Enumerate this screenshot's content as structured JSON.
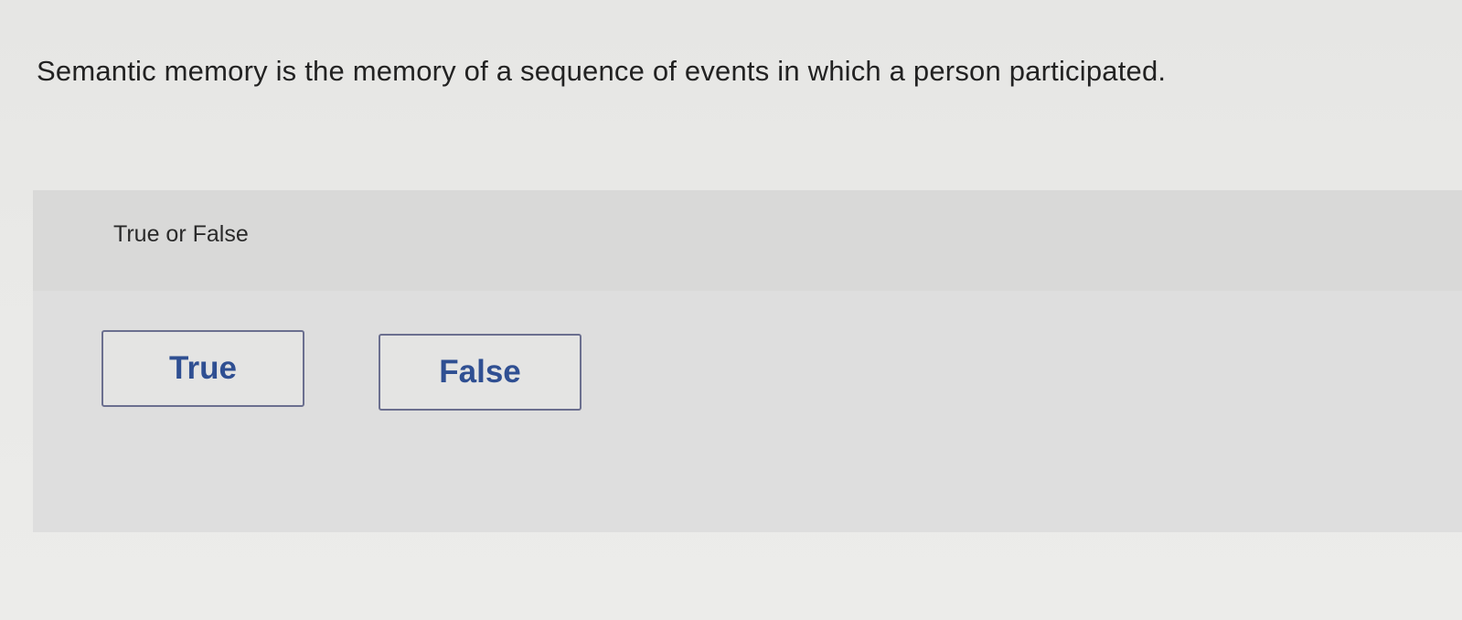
{
  "question": {
    "text": "Semantic memory is the memory of a sequence of events in which a person participated."
  },
  "answer_area": {
    "prompt": "True or False",
    "choices": [
      {
        "label": "True"
      },
      {
        "label": "False"
      }
    ]
  },
  "colors": {
    "button_text": "#2f4f92",
    "button_border": "#6b6f8f",
    "panel_background": "#dedede"
  }
}
